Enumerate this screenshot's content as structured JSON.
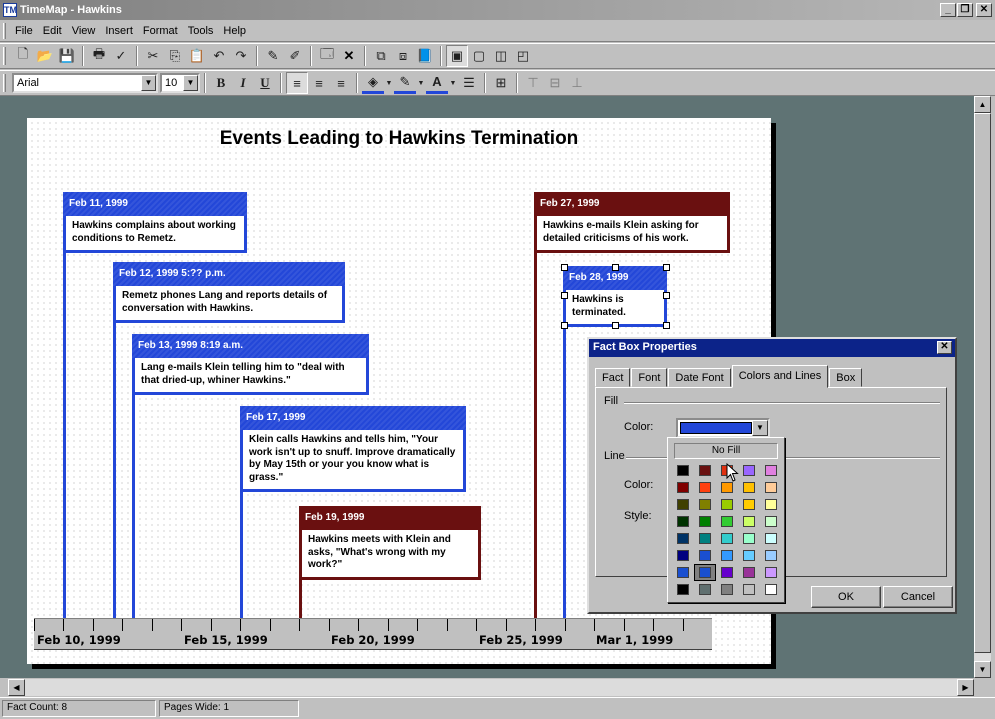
{
  "window": {
    "title": "TimeMap - Hawkins",
    "app_icon": "TM"
  },
  "menu": [
    "File",
    "Edit",
    "View",
    "Insert",
    "Format",
    "Tools",
    "Help"
  ],
  "format_toolbar": {
    "font": "Arial",
    "size": "10"
  },
  "chart_title": "Events Leading to Hawkins Termination",
  "facts": [
    {
      "date": "Feb 11, 1999",
      "text": "Hawkins complains about working conditions to Remetz.",
      "color": "#2347d8"
    },
    {
      "date": "Feb 12, 1999 5:?? p.m.",
      "text": "Remetz phones Lang and reports details of conversation with Hawkins.",
      "color": "#2347d8"
    },
    {
      "date": "Feb 13, 1999 8:19 a.m.",
      "text": "Lang e-mails Klein telling him to \"deal with that dried-up, whiner Hawkins.\"",
      "color": "#2347d8"
    },
    {
      "date": "Feb 17, 1999",
      "text": "Klein calls Hawkins and tells him, \"Your work isn't up to snuff.  Improve dramatically by May 15th or your you know what is grass.\"",
      "color": "#2347d8"
    },
    {
      "date": "Feb 19, 1999",
      "text": "Hawkins meets with Klein and asks, \"What's wrong with my work?\"",
      "color": "#6a1010"
    },
    {
      "date": "Feb 27, 1999",
      "text": "Hawkins e-mails Klein asking for detailed criticisms of his work.",
      "color": "#6a1010"
    },
    {
      "date": "Feb 28, 1999",
      "text": "Hawkins is terminated.",
      "color": "#2347d8"
    }
  ],
  "axis_labels": [
    "Feb 10, 1999",
    "Feb 15, 1999",
    "Feb 20, 1999",
    "Feb 25, 1999",
    "Mar 1, 1999"
  ],
  "dialog": {
    "title": "Fact Box Properties",
    "tabs": [
      "Fact",
      "Font",
      "Date Font",
      "Colors and Lines",
      "Box"
    ],
    "active_tab": "Colors and Lines",
    "fill_group": "Fill",
    "line_group": "Line",
    "fill_color_label": "Color:",
    "line_color_label": "Color:",
    "line_style_label": "Style:",
    "fill_color_value": "#2347d8",
    "ok": "OK",
    "cancel": "Cancel"
  },
  "palette": {
    "no_fill": "No Fill",
    "selected_color": "#1a4fd0",
    "colors": [
      "#000000",
      "#6a1010",
      "#e03010",
      "#9966ff",
      "#e080e0",
      "#800000",
      "#ff4010",
      "#ff9900",
      "#ffc000",
      "#ffcc99",
      "#404000",
      "#808000",
      "#99cc00",
      "#ffcc00",
      "#ffff99",
      "#003300",
      "#008000",
      "#33cc33",
      "#ccff66",
      "#ccffcc",
      "#003366",
      "#008080",
      "#33cccc",
      "#99ffcc",
      "#ccffff",
      "#000080",
      "#1a4fd0",
      "#3399ff",
      "#66ccff",
      "#99ccff",
      "#1a4fd0",
      "#1a4fd0",
      "#6600cc",
      "#993399",
      "#cc99ff",
      "#000000",
      "#607070",
      "#808080",
      "#c0c0c0",
      "#ffffff"
    ]
  },
  "status": {
    "fact_count": "Fact Count: 8",
    "pages_wide": "Pages Wide: 1"
  }
}
